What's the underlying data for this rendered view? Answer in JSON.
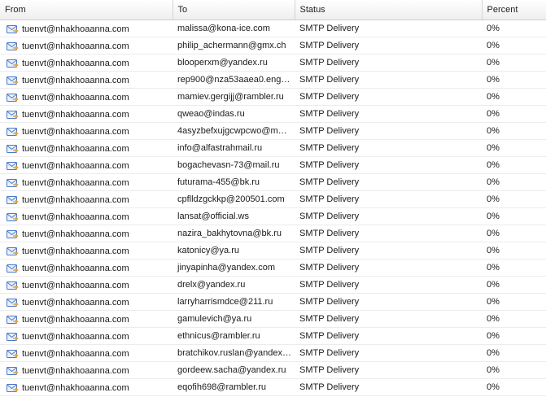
{
  "columns": {
    "from": "From",
    "to": "To",
    "status": "Status",
    "percent": "Percent"
  },
  "icons": {
    "row_icon": "envelope-arrow-icon",
    "envelope_color": "#4a78c8",
    "arrow_color": "#e8a23a"
  },
  "rows": [
    {
      "from": "tuenvt@nhakhoaanna.com",
      "to": "malissa@kona-ice.com",
      "status": "SMTP Delivery",
      "percent": "0%"
    },
    {
      "from": "tuenvt@nhakhoaanna.com",
      "to": "philip_achermann@gmx.ch",
      "status": "SMTP Delivery",
      "percent": "0%"
    },
    {
      "from": "tuenvt@nhakhoaanna.com",
      "to": "blooperxm@yandex.ru",
      "status": "SMTP Delivery",
      "percent": "0%"
    },
    {
      "from": "tuenvt@nhakhoaanna.com",
      "to": "rep900@nza53aaea0.eng…",
      "status": "SMTP Delivery",
      "percent": "0%"
    },
    {
      "from": "tuenvt@nhakhoaanna.com",
      "to": "mamiev.gergijj@rambler.ru",
      "status": "SMTP Delivery",
      "percent": "0%"
    },
    {
      "from": "tuenvt@nhakhoaanna.com",
      "to": "qweao@indas.ru",
      "status": "SMTP Delivery",
      "percent": "0%"
    },
    {
      "from": "tuenvt@nhakhoaanna.com",
      "to": "4asyzbefxujgcwpcwo@m…",
      "status": "SMTP Delivery",
      "percent": "0%"
    },
    {
      "from": "tuenvt@nhakhoaanna.com",
      "to": "info@alfastrahmail.ru",
      "status": "SMTP Delivery",
      "percent": "0%"
    },
    {
      "from": "tuenvt@nhakhoaanna.com",
      "to": "bogachevasn-73@mail.ru",
      "status": "SMTP Delivery",
      "percent": "0%"
    },
    {
      "from": "tuenvt@nhakhoaanna.com",
      "to": "futurama-455@bk.ru",
      "status": "SMTP Delivery",
      "percent": "0%"
    },
    {
      "from": "tuenvt@nhakhoaanna.com",
      "to": "cpflldzgckkp@200501.com",
      "status": "SMTP Delivery",
      "percent": "0%"
    },
    {
      "from": "tuenvt@nhakhoaanna.com",
      "to": "lansat@official.ws",
      "status": "SMTP Delivery",
      "percent": "0%"
    },
    {
      "from": "tuenvt@nhakhoaanna.com",
      "to": "nazira_bakhytovna@bk.ru",
      "status": "SMTP Delivery",
      "percent": "0%"
    },
    {
      "from": "tuenvt@nhakhoaanna.com",
      "to": "katonicy@ya.ru",
      "status": "SMTP Delivery",
      "percent": "0%"
    },
    {
      "from": "tuenvt@nhakhoaanna.com",
      "to": "jinyapinha@yandex.com",
      "status": "SMTP Delivery",
      "percent": "0%"
    },
    {
      "from": "tuenvt@nhakhoaanna.com",
      "to": "drelx@yandex.ru",
      "status": "SMTP Delivery",
      "percent": "0%"
    },
    {
      "from": "tuenvt@nhakhoaanna.com",
      "to": "larryharrismdce@211.ru",
      "status": "SMTP Delivery",
      "percent": "0%"
    },
    {
      "from": "tuenvt@nhakhoaanna.com",
      "to": "gamulevich@ya.ru",
      "status": "SMTP Delivery",
      "percent": "0%"
    },
    {
      "from": "tuenvt@nhakhoaanna.com",
      "to": "ethnicus@rambler.ru",
      "status": "SMTP Delivery",
      "percent": "0%"
    },
    {
      "from": "tuenvt@nhakhoaanna.com",
      "to": "bratchikov.ruslan@yandex…",
      "status": "SMTP Delivery",
      "percent": "0%"
    },
    {
      "from": "tuenvt@nhakhoaanna.com",
      "to": "gordeew.sacha@yandex.ru",
      "status": "SMTP Delivery",
      "percent": "0%"
    },
    {
      "from": "tuenvt@nhakhoaanna.com",
      "to": "eqofih698@rambler.ru",
      "status": "SMTP Delivery",
      "percent": "0%"
    }
  ]
}
